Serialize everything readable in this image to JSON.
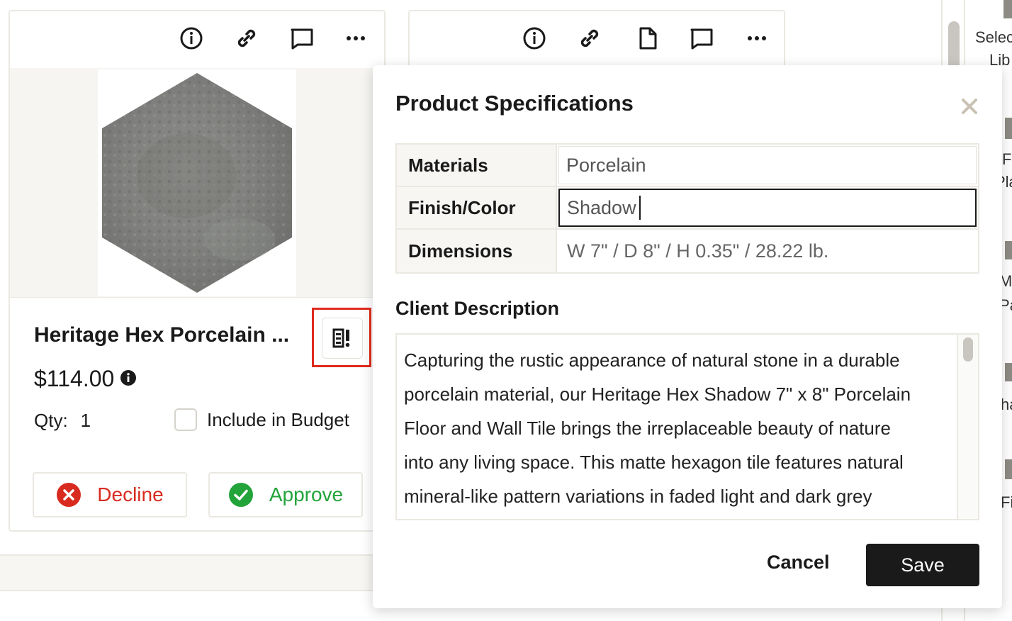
{
  "card": {
    "title": "Heritage Hex Porcelain ...",
    "price": "$114.00",
    "qty_label": "Qty:",
    "qty_value": "1",
    "budget_label": "Include in Budget",
    "decline_label": "Decline",
    "approve_label": "Approve"
  },
  "right_panel": {
    "fragments": [
      "Selec",
      "Lib",
      "F",
      "Pla",
      "Mo",
      "Pa",
      "ha",
      "Fi"
    ]
  },
  "modal": {
    "title": "Product Specifications",
    "specs": [
      {
        "label": "Materials",
        "value": "Porcelain"
      },
      {
        "label": "Finish/Color",
        "value": "Shadow"
      },
      {
        "label": "Dimensions",
        "value": "W 7\" / D 8\" / H 0.35\" / 28.22 lb."
      }
    ],
    "description_heading": "Client Description",
    "description_lines": [
      "Capturing the rustic appearance of natural stone in a durable",
      "porcelain material, our Heritage Hex Shadow 7\" x 8\" Porcelain",
      "Floor and Wall Tile brings the irreplaceable beauty of nature",
      "into any living space. This matte hexagon tile features natural",
      "mineral-like pattern variations in faded light and dark grey"
    ],
    "cancel_label": "Cancel",
    "save_label": "Save"
  },
  "colors": {
    "decline": "#d82a1f",
    "approve": "#23a43a",
    "highlight": "#e02a1c",
    "save_bg": "#1a1a1a"
  }
}
